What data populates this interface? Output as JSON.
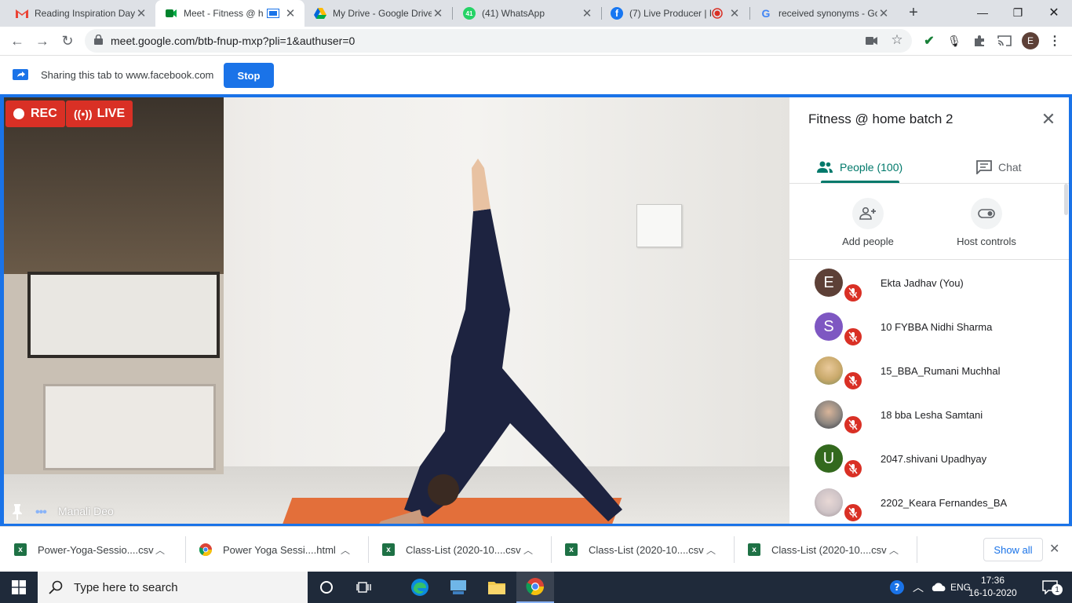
{
  "browser": {
    "tabs": [
      {
        "title": "Reading Inspiration Day",
        "favicon": "gmail-icon"
      },
      {
        "title": "Meet - Fitness @ h",
        "favicon": "meet-icon"
      },
      {
        "title": "My Drive - Google Drive",
        "favicon": "drive-icon"
      },
      {
        "title": "(41) WhatsApp",
        "favicon": "whatsapp-icon"
      },
      {
        "title": "(7) Live Producer | F",
        "favicon": "facebook-icon"
      },
      {
        "title": "received synonyms - Go",
        "favicon": "google-icon"
      }
    ],
    "whatsapp_badge": "41",
    "url": "meet.google.com/btb-fnup-mxp?pli=1&authuser=0",
    "profile_initial": "E"
  },
  "sharing": {
    "text": "Sharing this tab to www.facebook.com",
    "stop_label": "Stop"
  },
  "video": {
    "rec_label": "REC",
    "live_label": "LIVE",
    "speaker_name": "Manali Deo"
  },
  "panel": {
    "title": "Fitness @ home batch 2",
    "people_tab": "People (100)",
    "chat_tab": "Chat",
    "add_people": "Add people",
    "host_controls": "Host controls",
    "participants": [
      {
        "name": "Ekta Jadhav (You)",
        "initial": "E",
        "color": "#5d4037"
      },
      {
        "name": "10 FYBBA Nidhi Sharma",
        "initial": "S",
        "color": "#7e57c2"
      },
      {
        "name": "15_BBA_Rumani Muchhal",
        "initial": "",
        "color": "#c9a96b"
      },
      {
        "name": "18 bba Lesha Samtani",
        "initial": "",
        "color": "#8d8680"
      },
      {
        "name": "2047.shivani Upadhyay",
        "initial": "U",
        "color": "#33691e"
      },
      {
        "name": "2202_Keara Fernandes_BA",
        "initial": "",
        "color": "#cfc4c7"
      }
    ]
  },
  "downloads": {
    "items": [
      {
        "name": "Power-Yoga-Sessio....csv",
        "type": "excel"
      },
      {
        "name": "Power Yoga Sessi....html",
        "type": "chrome"
      },
      {
        "name": "Class-List (2020-10....csv",
        "type": "excel"
      },
      {
        "name": "Class-List (2020-10....csv",
        "type": "excel"
      },
      {
        "name": "Class-List (2020-10....csv",
        "type": "excel"
      }
    ],
    "show_all": "Show all"
  },
  "taskbar": {
    "search_placeholder": "Type here to search",
    "language": "ENG",
    "time": "17:36",
    "date": "16-10-2020",
    "notification_count": "1"
  }
}
